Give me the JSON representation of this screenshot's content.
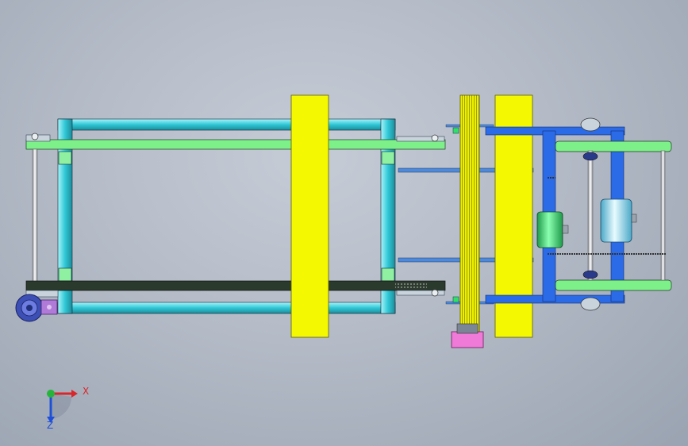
{
  "viewport": {
    "background_colors": [
      "#c6ccd6",
      "#9aa3b1"
    ]
  },
  "model": {
    "colors": {
      "frame": "#2fc7d6",
      "frame_dark": "#1c8c99",
      "rail_green": "#7df08a",
      "belt_dark": "#2a3a2c",
      "yellow_panel": "#f4f800",
      "blue_bracket": "#2b6be8",
      "motor_green": "#48e07a",
      "motor_cyan": "#9fe0f4",
      "gearbox_blue": "#3c4fb4",
      "pink_block": "#f07ad8"
    }
  },
  "triad": {
    "x_label": "X",
    "z_label": "Z",
    "x_color": "#d8262a",
    "y_color": "#26b43a",
    "z_color": "#1e4fd8"
  }
}
